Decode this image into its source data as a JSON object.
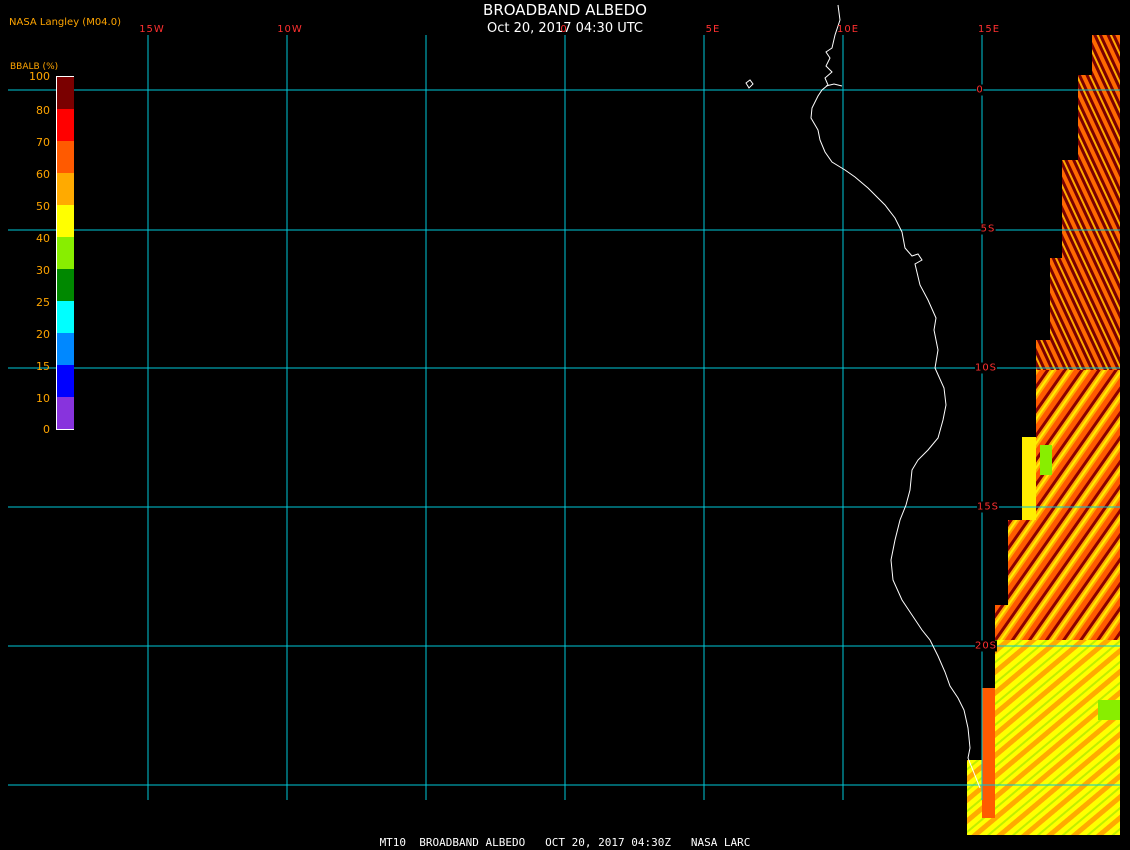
{
  "title": "BROADBAND ALBEDO",
  "subtitle": "Oct 20, 2017 04:30 UTC",
  "credit": "NASA Langley (M04.0)",
  "footer": "MT10  BROADBAND ALBEDO   OCT 20, 2017 04:30Z   NASA LARC",
  "legend": {
    "title": "BBALB (%)",
    "labels": [
      "100",
      "80",
      "70",
      "60",
      "50",
      "40",
      "30",
      "25",
      "20",
      "15",
      "10",
      "0"
    ],
    "colors": [
      "#7a0000",
      "#ff0000",
      "#ff5a00",
      "#ffaa00",
      "#ffff00",
      "#88ee00",
      "#008800",
      "#00ffff",
      "#0088ff",
      "#0000ff",
      "#8833dd"
    ]
  },
  "grid": {
    "longitude_labels": [
      "15W",
      "10W",
      "0",
      "5E",
      "10E",
      "15E"
    ],
    "latitude_labels": [
      "0",
      "5S",
      "10S",
      "15S",
      "20S"
    ]
  },
  "colors": {
    "grid": "#00c8d8",
    "label": "#ff3030",
    "credit": "#ffa500",
    "coastline": "#ffffff",
    "background": "#000000"
  }
}
